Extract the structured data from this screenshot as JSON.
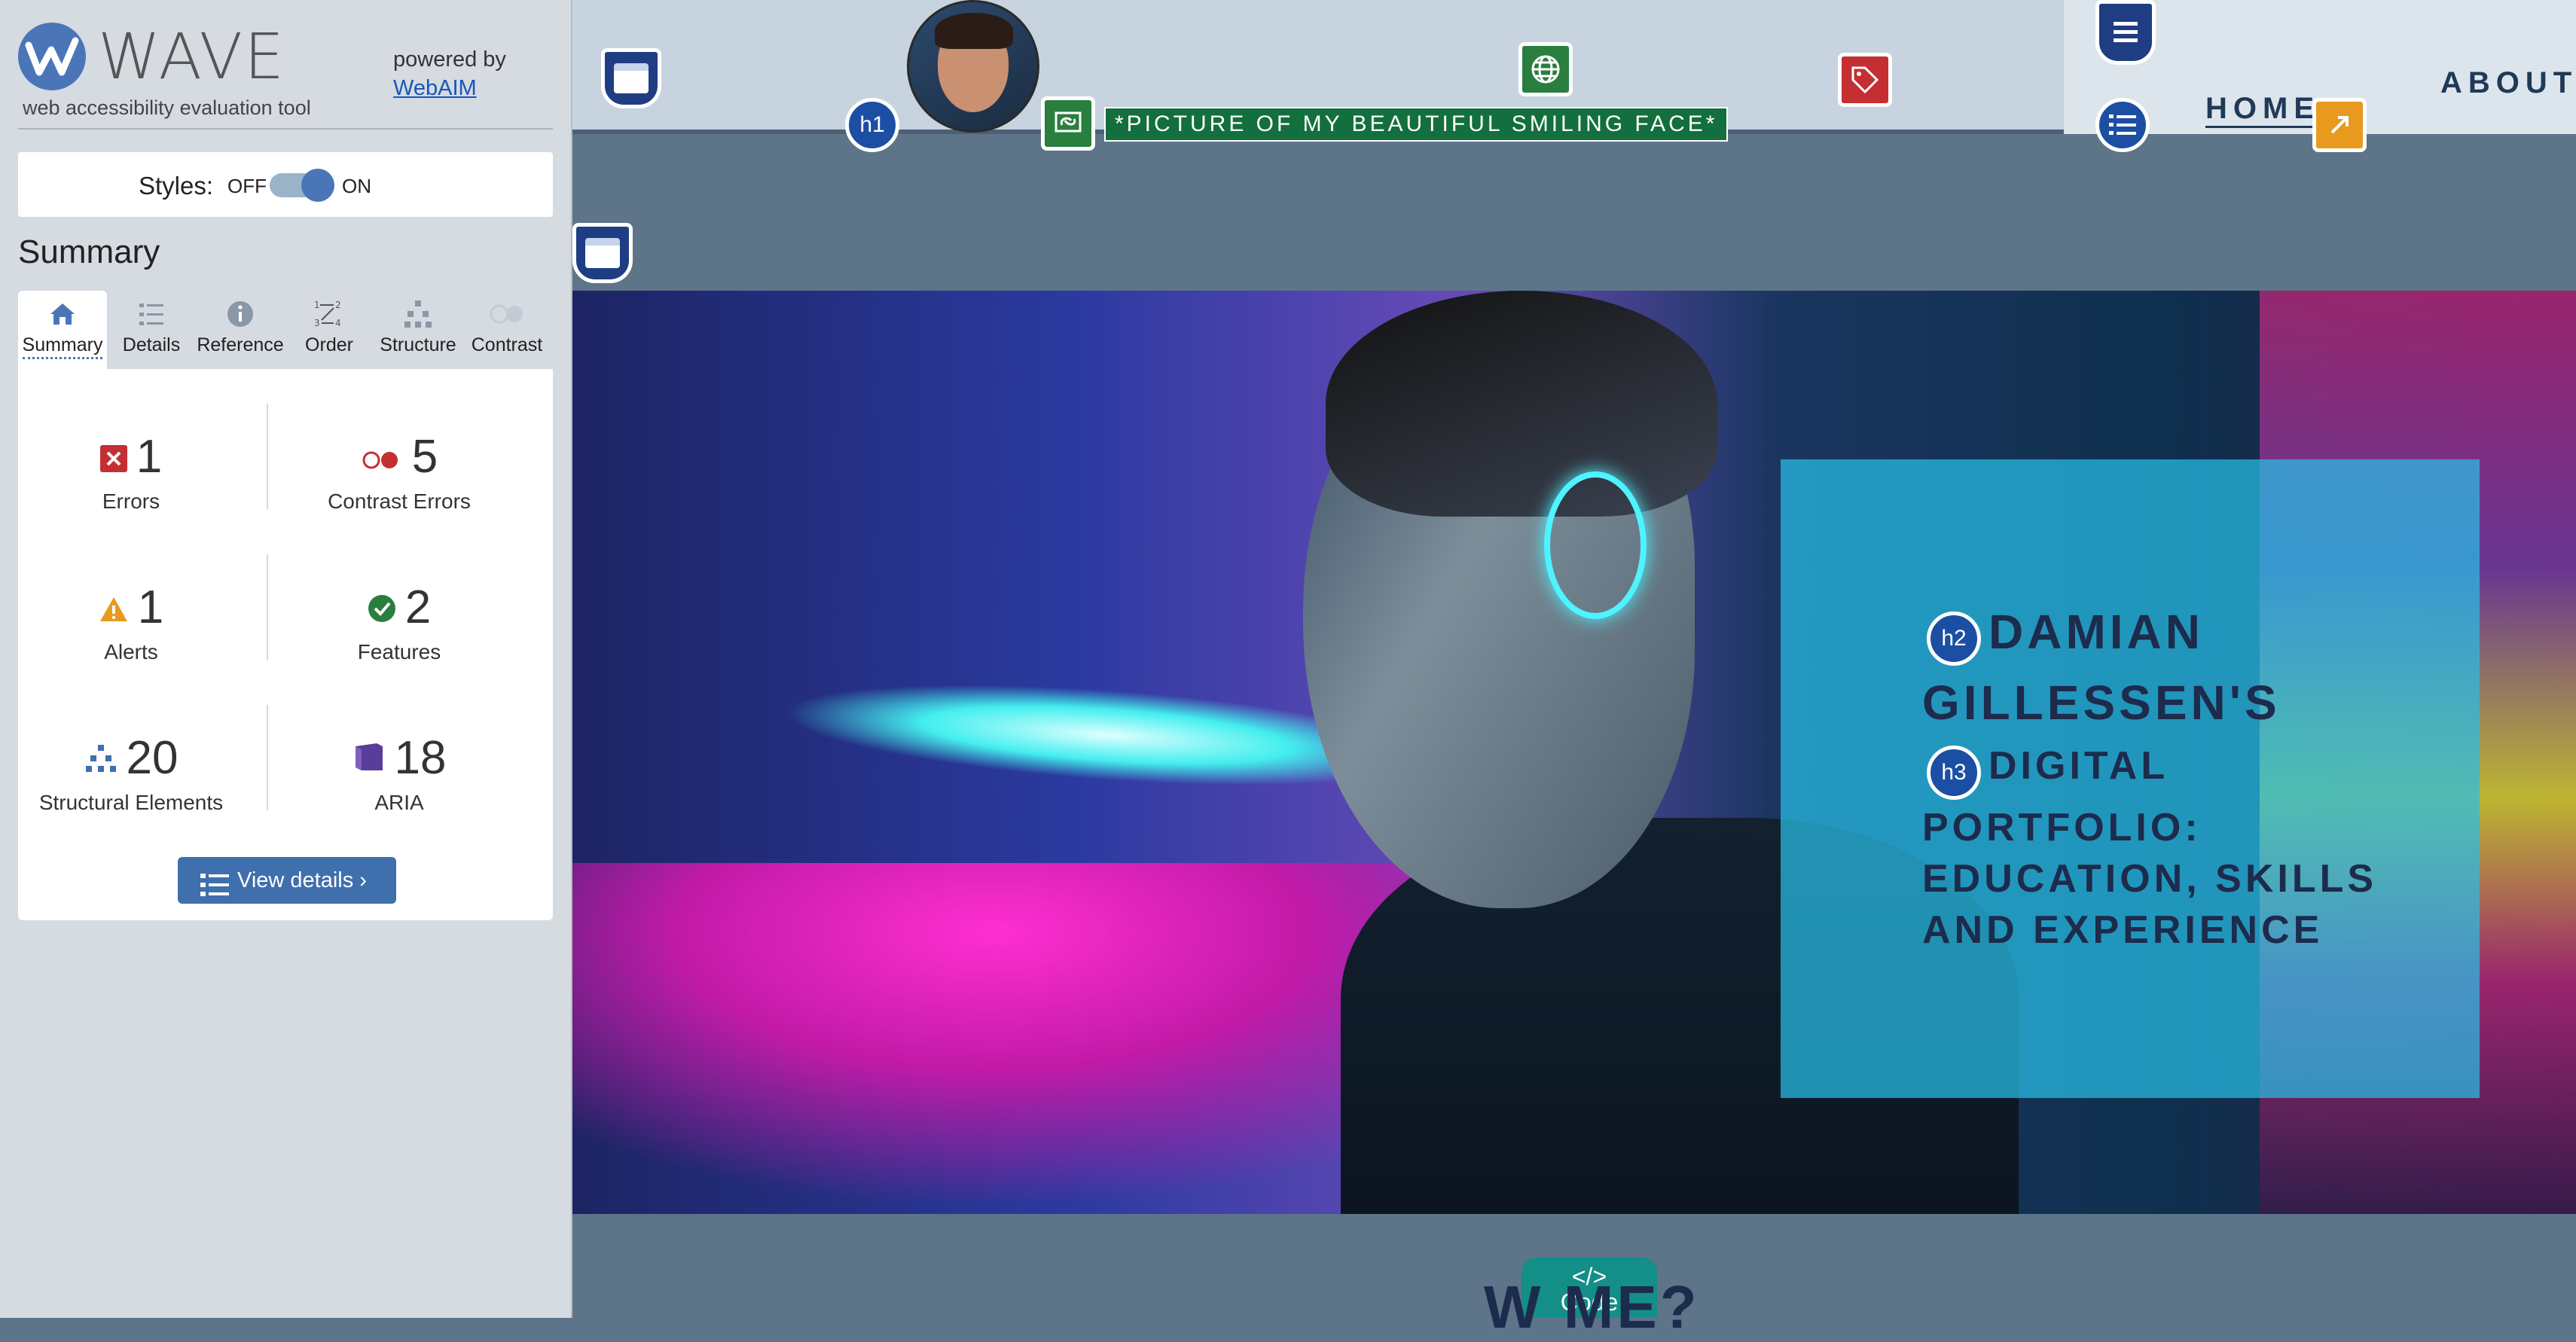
{
  "wave": {
    "title": "WAVE",
    "subtitle": "web accessibility evaluation tool",
    "powered_by": "powered by",
    "webaim_link": "WebAIM",
    "styles_label": "Styles:",
    "styles_off": "OFF",
    "styles_on": "ON",
    "summary_heading": "Summary",
    "tabs": [
      {
        "label": "Summary",
        "icon": "home-icon"
      },
      {
        "label": "Details",
        "icon": "list-icon"
      },
      {
        "label": "Reference",
        "icon": "info-icon"
      },
      {
        "label": "Order",
        "icon": "order-icon"
      },
      {
        "label": "Structure",
        "icon": "structure-icon"
      },
      {
        "label": "Contrast",
        "icon": "contrast-icon"
      }
    ],
    "stats": {
      "errors": {
        "value": "1",
        "label": "Errors"
      },
      "contrast_errors": {
        "value": "5",
        "label": "Contrast Errors"
      },
      "alerts": {
        "value": "1",
        "label": "Alerts"
      },
      "features": {
        "value": "2",
        "label": "Features"
      },
      "structural": {
        "value": "20",
        "label": "Structural Elements"
      },
      "aria": {
        "value": "18",
        "label": "ARIA"
      }
    },
    "view_details": "View details ›"
  },
  "page": {
    "nav": {
      "home": "HOME",
      "about": "ABOUT"
    },
    "alt_text": "*PICTURE OF MY BEAUTIFUL SMILING FACE*",
    "h1_marker": "h1",
    "h2_marker": "h2",
    "h3_marker": "h3",
    "title_line1": "DAMIAN",
    "title_line2": "GILLESSEN'S",
    "subtitle_line1": "DIGITAL",
    "subtitle_line2": "PORTFOLIO:",
    "subtitle_line3": "EDUCATION, SKILLS",
    "subtitle_line4": "AND EXPERIENCE",
    "code_tab_icon": "</>",
    "code_tab_label": "Code",
    "bottom_heading": "W          ME?"
  },
  "colors": {
    "wave_blue": "#4a76b8",
    "error_red": "#c42f34",
    "alert_orange": "#e89a1e",
    "feature_green": "#2a7e3e",
    "aria_purple": "#5a3c9a",
    "title_box": "#28bee6"
  }
}
